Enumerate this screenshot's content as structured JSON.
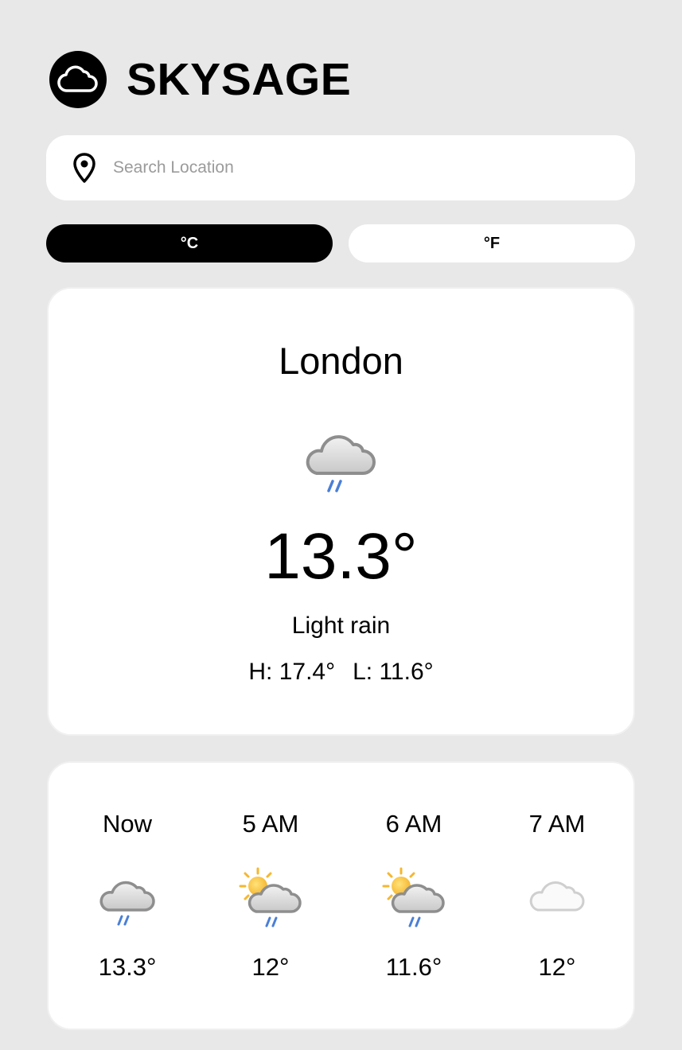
{
  "app": {
    "brand": "SKYSAGE",
    "logo_icon": "cloud-icon"
  },
  "search": {
    "placeholder": "Search Location",
    "value": "",
    "icon": "location-pin-icon"
  },
  "units": {
    "celsius_label": "°C",
    "fahrenheit_label": "°F",
    "selected": "°C"
  },
  "current": {
    "city": "London",
    "icon": "cloud-rain-icon",
    "temperature": "13.3°",
    "condition": "Light rain",
    "high": "H: 17.4°",
    "low": "L: 11.6°"
  },
  "hourly": [
    {
      "time": "Now",
      "icon": "cloud-rain-icon",
      "temperature": "13.3°"
    },
    {
      "time": "5 AM",
      "icon": "sun-cloud-rain-icon",
      "temperature": "12°"
    },
    {
      "time": "6 AM",
      "icon": "sun-cloud-rain-icon",
      "temperature": "11.6°"
    },
    {
      "time": "7 AM",
      "icon": "cloud-icon",
      "temperature": "12°"
    }
  ],
  "colors": {
    "background": "#e8e8e8",
    "card": "#ffffff",
    "accent": "#000000",
    "rain": "#4a7fd6",
    "sun": "#f5b731"
  }
}
